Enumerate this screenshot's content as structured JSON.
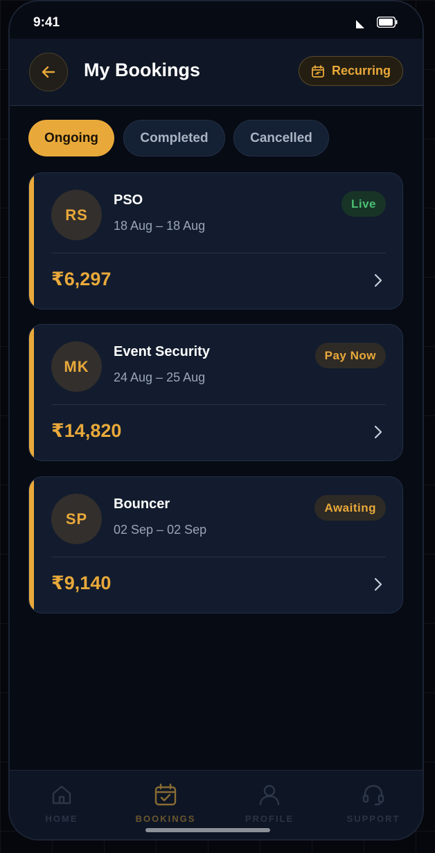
{
  "status_bar": {
    "time": "9:41"
  },
  "header": {
    "title": "My Bookings",
    "recurring_label": "Recurring"
  },
  "tabs": [
    {
      "label": "Ongoing",
      "active": true
    },
    {
      "label": "Completed",
      "active": false
    },
    {
      "label": "Cancelled",
      "active": false
    }
  ],
  "bookings": [
    {
      "initials": "RS",
      "service": "PSO",
      "dates": "18 Aug – 18 Aug",
      "status": "Live",
      "amount": "₹6,297"
    },
    {
      "initials": "MK",
      "service": "Event Security",
      "dates": "24 Aug – 25 Aug",
      "status": "Pay Now",
      "amount": "₹14,820"
    },
    {
      "initials": "SP",
      "service": "Bouncer",
      "dates": "02 Sep – 02 Sep",
      "status": "Awaiting",
      "amount": "₹9,140"
    }
  ],
  "bottom_nav": [
    {
      "label": "HOME",
      "icon": "home-icon",
      "active": false
    },
    {
      "label": "BOOKINGS",
      "icon": "calendar-check-icon",
      "active": true
    },
    {
      "label": "PROFILE",
      "icon": "user-icon",
      "active": false
    },
    {
      "label": "SUPPORT",
      "icon": "headset-icon",
      "active": false
    }
  ],
  "colors": {
    "accent": "#e9a93a",
    "background": "#070b14",
    "card": "#121c2e",
    "live_green": "#4cc074"
  }
}
